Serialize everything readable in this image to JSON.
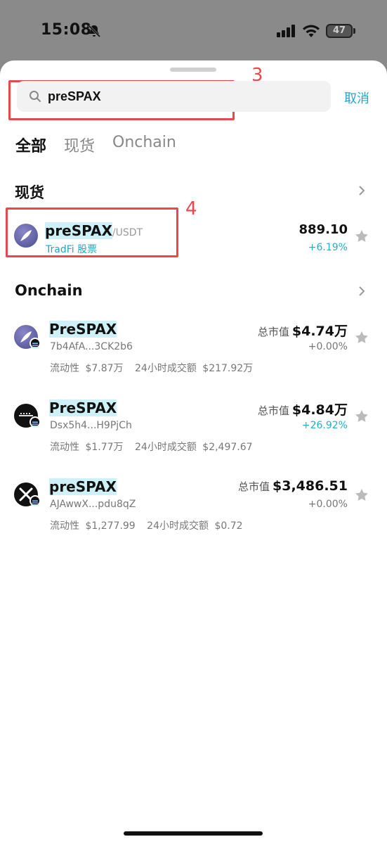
{
  "status": {
    "time": "15:08",
    "battery": "47"
  },
  "annotations": {
    "search_num": "3",
    "spot_num": "4"
  },
  "search": {
    "query": "preSPAX",
    "cancel": "取消"
  },
  "tabs": [
    {
      "label": "全部",
      "active": true
    },
    {
      "label": "现货",
      "active": false
    },
    {
      "label": "Onchain",
      "active": false
    }
  ],
  "spot": {
    "title": "现货",
    "item": {
      "name": "preSPAX",
      "pair": "/USDT",
      "tag": "TradFi 股票",
      "price": "889.10",
      "change": "+6.19%"
    }
  },
  "onchain": {
    "title": "Onchain",
    "items": [
      {
        "name": "PreSPAX",
        "address": "7b4AfA...3CK2b6",
        "mcap_label": "总市值",
        "mcap": "$4.74万",
        "change": "+0.00%",
        "liq_label": "流动性",
        "liq": "$7.87万",
        "vol_label": "24小时成交额",
        "vol": "$217.92万"
      },
      {
        "name": "PreSPAX",
        "address": "Dsx5h4...H9PjCh",
        "mcap_label": "总市值",
        "mcap": "$4.84万",
        "change": "+26.92%",
        "liq_label": "流动性",
        "liq": "$1.77万",
        "vol_label": "24小时成交额",
        "vol": "$2,497.67"
      },
      {
        "name": "preSPAX",
        "address": "AJAwwX...pdu8qZ",
        "mcap_label": "总市值",
        "mcap": "$3,486.51",
        "change": "+0.00%",
        "liq_label": "流动性",
        "liq": "$1,277.99",
        "vol_label": "24小时成交额",
        "vol": "$0.72"
      }
    ]
  },
  "colors": {
    "accent": "#1fa8c4",
    "annotation": "#e8474c",
    "highlight": "#cdf1f7"
  }
}
